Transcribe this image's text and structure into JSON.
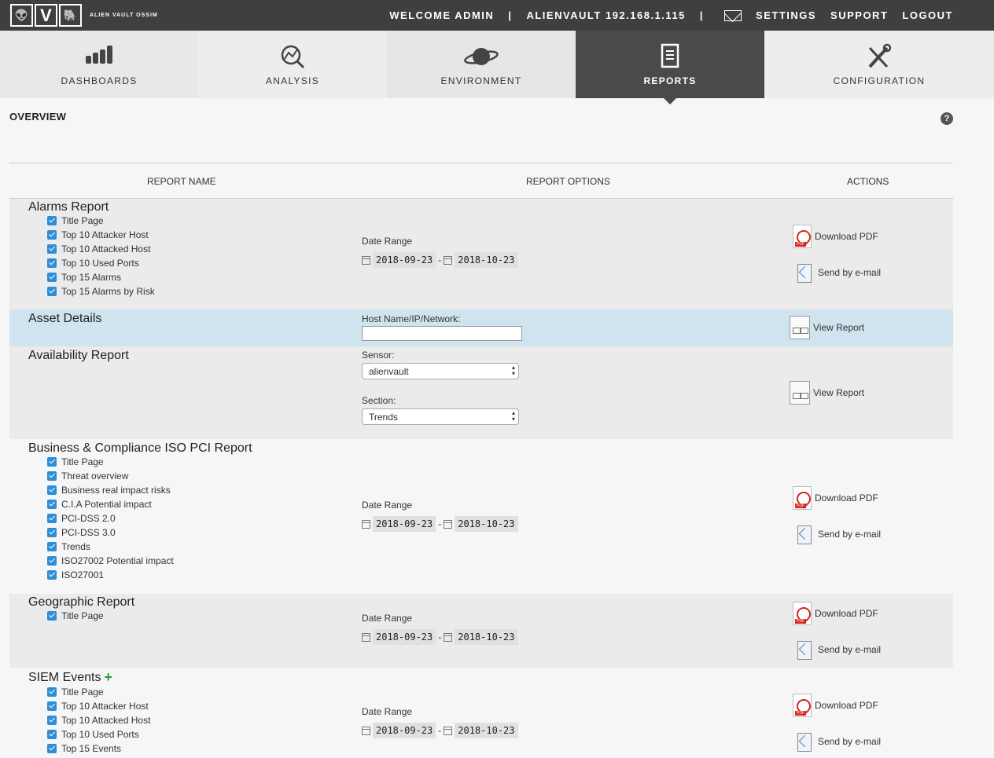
{
  "logo": {
    "letters": [
      "👽",
      "V",
      "🐘"
    ],
    "text": "ALIEN VAULT OSSIM"
  },
  "topnav": {
    "welcome": "WELCOME ADMIN",
    "sep": "|",
    "host": "ALIENVAULT 192.168.1.115",
    "settings": "SETTINGS",
    "support": "SUPPORT",
    "logout": "LOGOUT"
  },
  "mainnav": [
    "DASHBOARDS",
    "ANALYSIS",
    "ENVIRONMENT",
    "REPORTS",
    "CONFIGURATION"
  ],
  "page_title": "OVERVIEW",
  "help": "?",
  "table_headers": {
    "name": "REPORT NAME",
    "options": "REPORT OPTIONS",
    "actions": "ACTIONS"
  },
  "labels": {
    "date_range": "Date Range",
    "download_pdf": "Download PDF",
    "send_email": "Send by e-mail",
    "view_report": "View Report",
    "host_label": "Host Name/IP/Network:",
    "sensor_label": "Sensor:",
    "section_label": "Section:",
    "date_sep": "-"
  },
  "dates": {
    "from": "2018-09-23",
    "to": "2018-10-23"
  },
  "reports": {
    "alarms": {
      "title": "Alarms Report",
      "items": [
        "Title Page",
        "Top 10 Attacker Host",
        "Top 10 Attacked Host",
        "Top 10 Used Ports",
        "Top 15 Alarms",
        "Top 15 Alarms by Risk"
      ]
    },
    "asset": {
      "title": "Asset Details",
      "host_value": ""
    },
    "availability": {
      "title": "Availability Report",
      "sensor": "alienvault",
      "section": "Trends"
    },
    "business": {
      "title": "Business & Compliance ISO PCI Report",
      "items": [
        "Title Page",
        "Threat overview",
        "Business real impact risks",
        "C.I.A Potential impact",
        "PCI-DSS 2.0",
        "PCI-DSS 3.0",
        "Trends",
        "ISO27002 Potential impact",
        "ISO27001"
      ]
    },
    "geographic": {
      "title": "Geographic Report",
      "items": [
        "Title Page"
      ]
    },
    "siem": {
      "title": "SIEM Events",
      "items": [
        "Title Page",
        "Top 10 Attacker Host",
        "Top 10 Attacked Host",
        "Top 10 Used Ports",
        "Top 15 Events"
      ]
    }
  }
}
